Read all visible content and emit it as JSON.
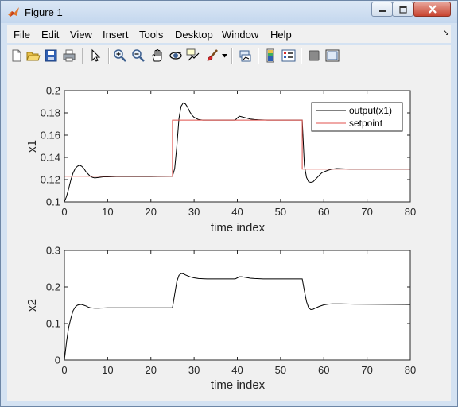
{
  "window": {
    "title": "Figure 1",
    "colors": {
      "titlebar": "#c4d7ee",
      "close_button": "#c8432f",
      "background": "#f0f0f0"
    }
  },
  "menubar": {
    "items": [
      "File",
      "Edit",
      "View",
      "Insert",
      "Tools",
      "Desktop",
      "Window",
      "Help"
    ]
  },
  "toolbar": {
    "icons": [
      "new-figure-icon",
      "open-file-icon",
      "save-icon",
      "print-icon",
      "pointer-icon",
      "zoom-in-icon",
      "zoom-out-icon",
      "pan-hand-icon",
      "rotate-3d-icon",
      "data-cursor-icon",
      "brush-icon",
      "brush-dropdown-icon",
      "link-plot-icon",
      "colorbar-icon",
      "legend-icon",
      "hide-plot-tools-icon",
      "show-plot-tools-icon"
    ]
  },
  "chart_data": [
    {
      "type": "line",
      "xlabel": "time index",
      "ylabel": "x1",
      "xlim": [
        0,
        80
      ],
      "ylim": [
        0.1,
        0.2
      ],
      "xticks": [
        "0",
        "10",
        "20",
        "30",
        "40",
        "50",
        "60",
        "70",
        "80"
      ],
      "yticks": [
        "0.1",
        "0.12",
        "0.14",
        "0.16",
        "0.18",
        "0.2"
      ],
      "legend": {
        "placement": "top-right",
        "entries": [
          "output(x1)",
          "setpoint"
        ]
      },
      "series": [
        {
          "name": "output(x1)",
          "color": "#000000",
          "x": [
            0,
            0.5,
            1,
            1.5,
            2,
            2.5,
            3,
            3.5,
            4,
            4.5,
            5,
            5.5,
            6,
            6.5,
            7,
            8,
            9,
            10,
            12,
            15,
            20,
            25,
            25.5,
            26,
            26.5,
            27,
            27.5,
            28,
            28.5,
            29,
            29.5,
            30,
            31,
            32,
            34,
            36,
            38,
            39.5,
            40,
            40.5,
            41,
            42,
            43,
            44,
            45,
            47,
            50,
            55,
            55.5,
            56,
            56.5,
            57,
            57.5,
            58,
            58.5,
            59,
            59.5,
            60,
            61,
            62,
            63,
            64,
            66,
            70,
            80
          ],
          "y": [
            0.1,
            0.105,
            0.112,
            0.12,
            0.126,
            0.13,
            0.132,
            0.133,
            0.132,
            0.13,
            0.127,
            0.125,
            0.123,
            0.122,
            0.1215,
            0.122,
            0.1225,
            0.1225,
            0.1228,
            0.1228,
            0.1228,
            0.123,
            0.13,
            0.15,
            0.175,
            0.186,
            0.189,
            0.188,
            0.185,
            0.181,
            0.178,
            0.176,
            0.174,
            0.1735,
            0.1735,
            0.1735,
            0.1735,
            0.1735,
            0.1755,
            0.177,
            0.1765,
            0.1755,
            0.1745,
            0.174,
            0.1738,
            0.1735,
            0.1735,
            0.1735,
            0.133,
            0.122,
            0.118,
            0.1175,
            0.118,
            0.12,
            0.122,
            0.124,
            0.126,
            0.127,
            0.1285,
            0.1295,
            0.13,
            0.1298,
            0.1295,
            0.1295,
            0.1295
          ]
        },
        {
          "name": "setpoint",
          "color": "#e0524c",
          "x": [
            0,
            25,
            25,
            55,
            55,
            80
          ],
          "y": [
            0.123,
            0.123,
            0.1735,
            0.1735,
            0.1295,
            0.1295
          ]
        }
      ]
    },
    {
      "type": "line",
      "xlabel": "time index",
      "ylabel": "x2",
      "xlim": [
        0,
        80
      ],
      "ylim": [
        0,
        0.3
      ],
      "xticks": [
        "0",
        "10",
        "20",
        "30",
        "40",
        "50",
        "60",
        "70",
        "80"
      ],
      "yticks": [
        "0",
        "0.1",
        "0.2",
        "0.3"
      ],
      "series": [
        {
          "color": "#000000",
          "x": [
            0,
            0.5,
            1,
            1.5,
            2,
            2.5,
            3,
            3.5,
            4,
            4.5,
            5,
            5.5,
            6,
            7,
            8,
            10,
            15,
            20,
            25,
            25.5,
            26,
            26.5,
            27,
            27.5,
            28,
            29,
            30,
            31,
            33,
            36,
            39.5,
            40,
            40.5,
            41,
            42,
            43,
            44,
            46,
            50,
            55,
            55.5,
            56,
            56.5,
            57,
            57.5,
            58,
            59,
            60,
            61,
            62,
            64,
            67,
            80
          ],
          "y": [
            0,
            0.05,
            0.09,
            0.115,
            0.135,
            0.145,
            0.15,
            0.152,
            0.152,
            0.15,
            0.148,
            0.145,
            0.143,
            0.142,
            0.142,
            0.143,
            0.143,
            0.143,
            0.143,
            0.18,
            0.215,
            0.232,
            0.237,
            0.236,
            0.233,
            0.228,
            0.225,
            0.223,
            0.222,
            0.222,
            0.222,
            0.225,
            0.228,
            0.228,
            0.226,
            0.224,
            0.223,
            0.222,
            0.222,
            0.222,
            0.19,
            0.16,
            0.143,
            0.138,
            0.139,
            0.142,
            0.147,
            0.151,
            0.153,
            0.154,
            0.154,
            0.153,
            0.152
          ]
        }
      ]
    }
  ]
}
